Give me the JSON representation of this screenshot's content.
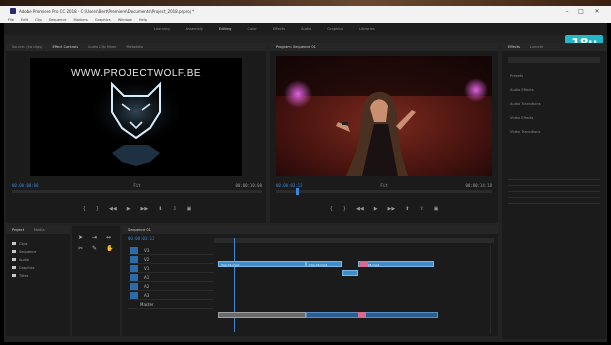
{
  "window": {
    "title": "Adobe Premiere Pro CC 2018 - C:\\Users\\Bert\\Premiere\\Documents\\Project_2018.prproj *",
    "minimize": "–",
    "maximize": "□",
    "close": "✕"
  },
  "menu": [
    "File",
    "Edit",
    "Clip",
    "Sequence",
    "Markers",
    "Graphics",
    "Window",
    "Help"
  ],
  "workspaces": [
    "Learning",
    "Assembly",
    "Editing",
    "Color",
    "Effects",
    "Audio",
    "Graphics",
    "Libraries"
  ],
  "source_monitor": {
    "tabs": [
      "Source: (no clips)",
      "Effect Controls",
      "Audio Clip Mixer",
      "Metadata"
    ],
    "watermark": "WWW.PROJECTWOLF.BE",
    "timecode_in": "00:00:00:00",
    "timecode_out": "00:00:10:00",
    "fit": "Fit"
  },
  "program_monitor": {
    "tabs": [
      "Program: Sequence 01"
    ],
    "timecode_in": "00:00:03:12",
    "timecode_out": "00:00:14:18",
    "fit": "Fit"
  },
  "badge": "18u",
  "project_panel": {
    "tabs": [
      "Project",
      "Media"
    ],
    "items": [
      "Clips",
      "Sequence",
      "Audio",
      "Graphics",
      "Titles"
    ]
  },
  "timeline": {
    "tab": "Sequence 01",
    "timecode": "00:00:03:12",
    "tracks_video": [
      "V3",
      "V2",
      "V1"
    ],
    "tracks_audio": [
      "A1",
      "A2",
      "A3"
    ],
    "master": "Master",
    "clip_labels": [
      "Clip 01.mp4",
      "Clip 02.mp4",
      "Clip 03.mp4"
    ]
  },
  "effects_panel": {
    "tabs": [
      "Effects",
      "Lumetri"
    ],
    "sections": [
      "Presets",
      "Audio Effects",
      "Audio Transitions",
      "Video Effects",
      "Video Transitions"
    ]
  },
  "colors": {
    "accent": "#3e86d6",
    "badge": "#23b8c7",
    "clip_video": "#3f8ec9",
    "clip_audio": "#2a5e92",
    "marker_pink": "#d96a8c"
  }
}
